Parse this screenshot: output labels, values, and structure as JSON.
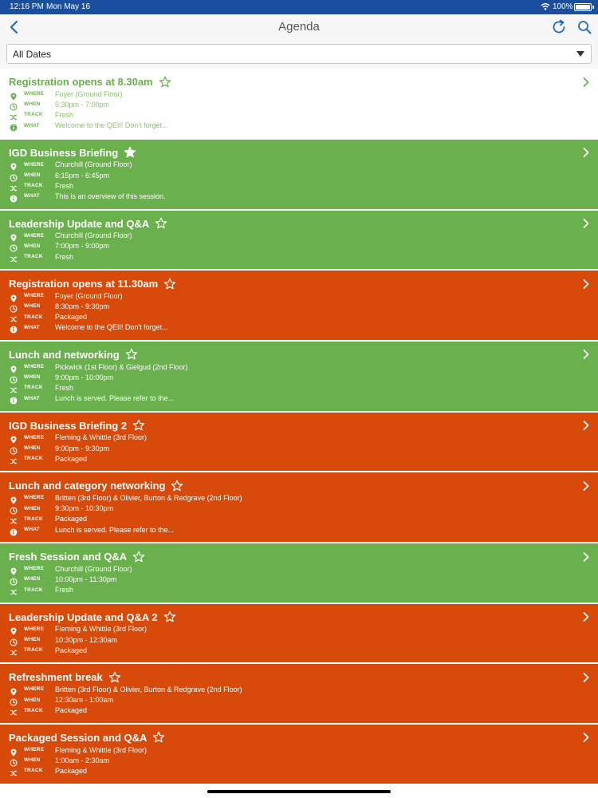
{
  "status_bar": {
    "time": "12:16 PM",
    "date": "Mon May 16",
    "battery": "100%"
  },
  "nav": {
    "title": "Agenda"
  },
  "filter": {
    "value": "All Dates"
  },
  "labels": {
    "where": "WHERE",
    "when": "WHEN",
    "track": "TRACK",
    "what": "WHAT"
  },
  "colors": {
    "fresh": "#6ab04c",
    "packaged": "#d84a0a",
    "status_bar": "#1a4fa0",
    "nav_icons": "#1a6fc0"
  },
  "items": [
    {
      "title": "Registration opens at 8.30am",
      "style": "white",
      "starred": false,
      "where": "Foyer (Ground Floor)",
      "when": "5:30pm - 7:00pm",
      "track": "Fresh",
      "what": "Welcome to the QEII! Don't forget..."
    },
    {
      "title": "IGD Business Briefing",
      "style": "green",
      "starred": true,
      "where": "Churchill (Ground Floor)",
      "when": "6:15pm - 6:45pm",
      "track": "Fresh",
      "what": "This is an overview of this session."
    },
    {
      "title": "Leadership Update and Q&A",
      "style": "green",
      "starred": false,
      "where": "Churchill (Ground Floor)",
      "when": "7:00pm - 9:00pm",
      "track": "Fresh",
      "what": ""
    },
    {
      "title": "Registration opens at 11.30am",
      "style": "orange",
      "starred": false,
      "where": "Foyer (Ground Floor)",
      "when": "8:30pm - 9:30pm",
      "track": "Packaged",
      "what": "Welcome to the QEII! Don't forget..."
    },
    {
      "title": "Lunch and networking",
      "style": "green",
      "starred": false,
      "where": "Pickwick (1st Floor) & Gielgud (2nd Floor)",
      "when": "9:00pm - 10:00pm",
      "track": "Fresh",
      "what": "Lunch is served. Please refer to the..."
    },
    {
      "title": "IGD Business Briefing 2",
      "style": "orange",
      "starred": false,
      "where": "Fleming & Whittle (3rd Floor)",
      "when": "9:00pm - 9:30pm",
      "track": "Packaged",
      "what": ""
    },
    {
      "title": "Lunch and category networking",
      "style": "orange",
      "starred": false,
      "where": "Britten (3rd Floor) & Olivier, Burton & Redgrave (2nd Floor)",
      "when": "9:30pm - 10:30pm",
      "track": "Packaged",
      "what": "Lunch is served. Please refer to the..."
    },
    {
      "title": "Fresh Session and Q&A",
      "style": "green",
      "starred": false,
      "where": "Churchill (Ground Floor)",
      "when": "10:00pm - 11:30pm",
      "track": "Fresh",
      "what": ""
    },
    {
      "title": "Leadership Update and Q&A 2",
      "style": "orange",
      "starred": false,
      "where": "Fleming & Whittle (3rd Floor)",
      "when": "10:30pm - 12:30am",
      "track": "Packaged",
      "what": ""
    },
    {
      "title": "Refreshment break",
      "style": "orange",
      "starred": false,
      "where": "Britten (3rd Floor) & Olivier, Burton & Redgrave (2nd Floor)",
      "when": "12:30am - 1:00am",
      "track": "Packaged",
      "what": ""
    },
    {
      "title": "Packaged Session and Q&A",
      "style": "orange",
      "starred": false,
      "where": "Fleming & Whittle (3rd Floor)",
      "when": "1:00am - 2:30am",
      "track": "Packaged",
      "what": ""
    }
  ]
}
